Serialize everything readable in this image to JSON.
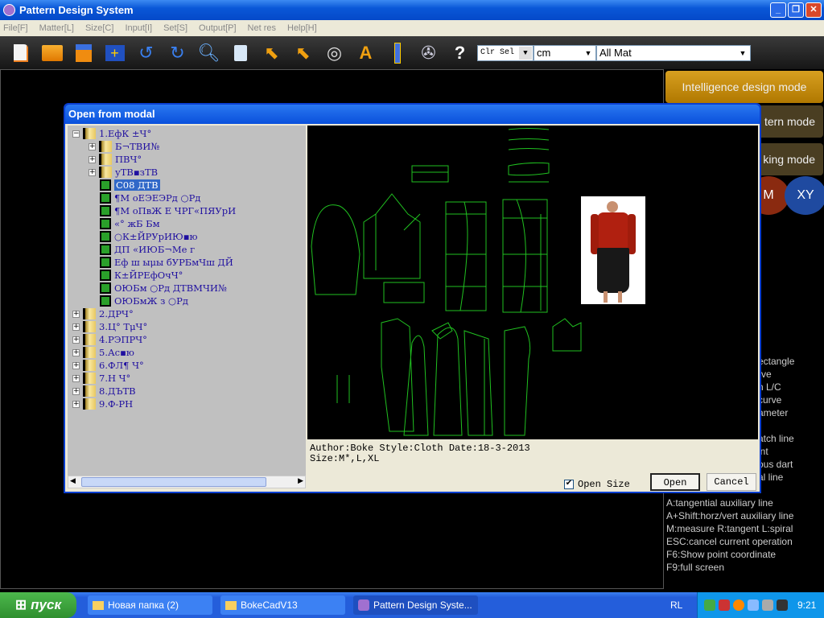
{
  "window": {
    "title": "Pattern Design System"
  },
  "menu": [
    "File[F]",
    "Matter[L]",
    "Size[C]",
    "Input[I]",
    "Set[S]",
    "Output[P]",
    "Net res",
    "Help[H]"
  ],
  "toolbar": {
    "icons": [
      "new-file",
      "open-folder",
      "save",
      "add-folder",
      "undo",
      "redo",
      "zoom",
      "recycle",
      "select-arrow",
      "curve-arrow",
      "lasso",
      "text",
      "ruler",
      "reel",
      "help"
    ],
    "help_label": "?",
    "text_label": "A",
    "color_select": "Clr Sel",
    "unit": "cm",
    "material": "All Mat"
  },
  "right_panel": {
    "modes": [
      "Intelligence design mode",
      "tern mode",
      "king mode"
    ],
    "circle_m": "M",
    "circle_xy": "XY",
    "partial_help": [
      "ectangle",
      "rve",
      "n L/C",
      "curve",
      "ameter",
      "atch line",
      "int",
      "ous dart",
      "al line"
    ],
    "help": [
      "A:tangential auxiliary line",
      "A+Shift:horz/vert auxiliary line",
      "M:measure  R:tangent  L:spiral",
      "ESC:cancel current operation",
      "F6:Show point coordinate",
      "F9:full screen"
    ]
  },
  "dialog": {
    "title": "Open from modal",
    "tree": [
      {
        "label": "1.ЕфК ±Ч°",
        "level": 0,
        "type": "folder",
        "expanded": true
      },
      {
        "label": "Б¬ТВИ№",
        "level": 1,
        "type": "folder"
      },
      {
        "label": "ПВЧ°",
        "level": 1,
        "type": "folder"
      },
      {
        "label": " уТВ▪зТВ",
        "level": 1,
        "type": "folder"
      },
      {
        "label": "C08  ДТВ",
        "level": 2,
        "type": "leaf",
        "selected": true
      },
      {
        "label": "¶М  оЕЭЕЭРд  ○Рд",
        "level": 2,
        "type": "leaf"
      },
      {
        "label": "¶М  оПвЖ  Е  ЧРГ«ПЯУрИ",
        "level": 2,
        "type": "leaf"
      },
      {
        "label": " «° жБ  Бм",
        "level": 2,
        "type": "leaf"
      },
      {
        "label": " ○К±ЙРУрИЮ▪ю",
        "level": 2,
        "type": "leaf"
      },
      {
        "label": "ДП  «ИЮБ¬Ме  г",
        "level": 2,
        "type": "leaf"
      },
      {
        "label": "Еф  ш  ыμы  бУРБмЧш  ДЙ",
        "level": 2,
        "type": "leaf"
      },
      {
        "label": "К±ЙРЕфОчЧ°",
        "level": 2,
        "type": "leaf"
      },
      {
        "label": "ОЮБм  ○Рд  ДТВМЧИ№",
        "level": 2,
        "type": "leaf"
      },
      {
        "label": "ОЮБмЖ    з  ○Рд",
        "level": 2,
        "type": "leaf"
      },
      {
        "label": "2.ДРЧ°",
        "level": 0,
        "type": "folder"
      },
      {
        "label": "3.Ц° ТμЧ°",
        "level": 0,
        "type": "folder"
      },
      {
        "label": "4.РЭПРЧ°",
        "level": 0,
        "type": "folder"
      },
      {
        "label": "5.Ас▪ю",
        "level": 0,
        "type": "folder"
      },
      {
        "label": "6.ФЛ¶  Ч°",
        "level": 0,
        "type": "folder"
      },
      {
        "label": "7.Н  Ч°",
        "level": 0,
        "type": "folder"
      },
      {
        "label": "8.ДЪТВ",
        "level": 0,
        "type": "folder"
      },
      {
        "label": "9.Ф-РН",
        "level": 0,
        "type": "folder"
      }
    ],
    "info_line1": "Author:Boke Style:Cloth Date:18-3-2013",
    "info_line2": "Size:M*,L,XL",
    "open_size_label": "Open Size",
    "open_size_checked": true,
    "open_label": "Open",
    "cancel_label": "Cancel"
  },
  "taskbar": {
    "start": "пуск",
    "tasks": [
      "Новая папка (2)",
      "BokeCadV13",
      "Pattern Design Syste..."
    ],
    "lang": "RL",
    "clock": "9:21"
  },
  "colors": {
    "pattern_line": "#20c020",
    "selection": "#3168c8",
    "mode_active": "#c08a10"
  }
}
